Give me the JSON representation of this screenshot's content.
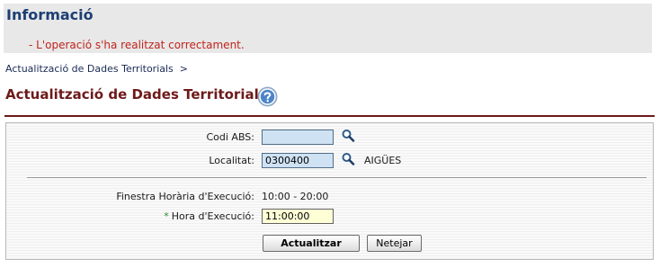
{
  "info": {
    "title": "Informació",
    "message": "- L'operació s'ha realitzat correctament."
  },
  "breadcrumb": {
    "item": "Actualització de Dades Territorials",
    "separator": ">"
  },
  "page": {
    "title": "Actualització de Dades Territorials",
    "help_icon": "question-help-icon"
  },
  "form": {
    "codi_abs": {
      "label": "Codi ABS:",
      "value": ""
    },
    "localitat": {
      "label": "Localitat:",
      "value": "0300400",
      "description": "AIGÜES"
    },
    "finestra": {
      "label": "Finestra Horària d'Execució:",
      "value": "10:00 - 20:00"
    },
    "hora": {
      "required_mark": "*",
      "label": "Hora d'Execució:",
      "value": "11:00:00"
    },
    "search_icon": "magnifier-icon",
    "buttons": {
      "update": "Actualitzar",
      "clear": "Netejar"
    }
  },
  "colors": {
    "info_title": "#1c3f73",
    "message": "#c0241c",
    "page_title": "#6d1a1a",
    "field_blue": "#cfe2f3",
    "field_yellow": "#ffffd6",
    "required": "#2e8b2e"
  }
}
